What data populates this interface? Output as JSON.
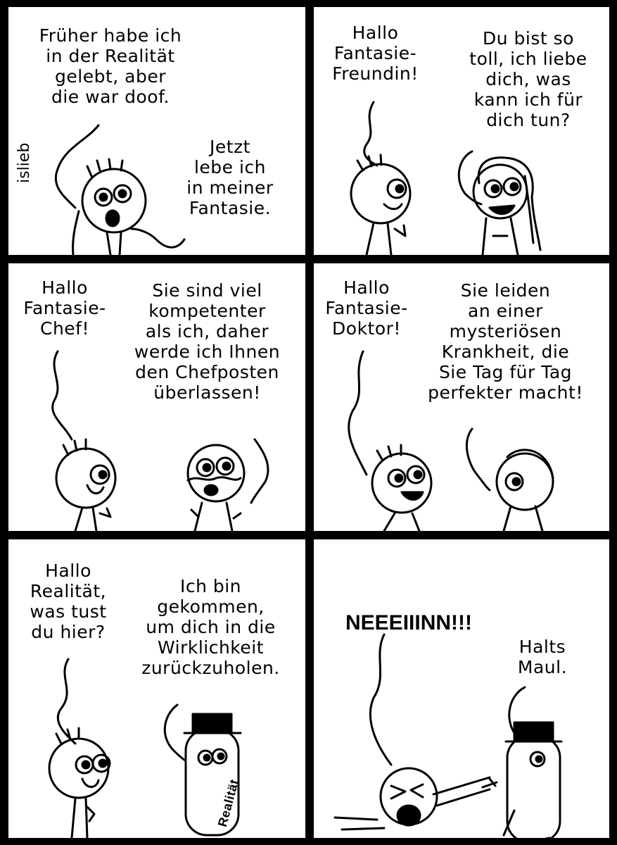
{
  "comic": {
    "signature": "islieb",
    "panels": [
      {
        "id": 1,
        "texts": [
          "Früher habe ich\nin der Realität\ngelebt, aber\ndie war doof.",
          "Jetzt\nlebe ich\nin meiner\nFantasie."
        ]
      },
      {
        "id": 2,
        "texts": [
          "Hallo\nFantasie-\nFreundin!",
          "Du bist so\ntoll, ich liebe\ndich, was\nkann ich für\ndich tun?"
        ]
      },
      {
        "id": 3,
        "texts": [
          "Hallo\nFantasie-\nChef!",
          "Sie sind viel\nkompetenter\nals ich, daher\nwerde ich Ihnen\nden Chefposten\nüberlassen!"
        ]
      },
      {
        "id": 4,
        "texts": [
          "Hallo\nFantasie-\nDoktor!",
          "Sie leiden\nan einer\nmysteriösen\nKrankheit, die\nSie Tag für Tag\nperfekter macht!"
        ]
      },
      {
        "id": 5,
        "texts": [
          "Hallo\nRealität,\nwas tust\ndu hier?",
          "Ich bin\ngekommen,\num dich in die\nWirklichkeit\nzurückzuholen."
        ],
        "label": "Realität"
      },
      {
        "id": 6,
        "texts": [
          "NEEEIIINN!!!",
          "Halts\nMaul."
        ]
      }
    ]
  }
}
